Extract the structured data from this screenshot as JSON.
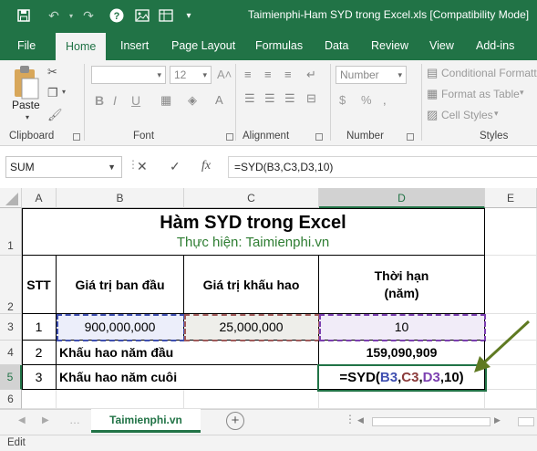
{
  "window": {
    "title": "Taimienphi-Ham SYD trong Excel.xls  [Compatibility Mode]"
  },
  "quick_access": [
    "save-icon",
    "undo-icon",
    "redo-icon",
    "help-icon",
    "image-icon",
    "format-icon",
    "customize-icon"
  ],
  "ribbon_tabs": [
    {
      "label": "File"
    },
    {
      "label": "Home"
    },
    {
      "label": "Insert"
    },
    {
      "label": "Page Layout"
    },
    {
      "label": "Formulas"
    },
    {
      "label": "Data"
    },
    {
      "label": "Review"
    },
    {
      "label": "View"
    },
    {
      "label": "Add-ins"
    }
  ],
  "active_tab": "Home",
  "ribbon": {
    "clipboard": {
      "paste_label": "Paste",
      "group_label": "Clipboard"
    },
    "font": {
      "font_size": "12",
      "group_label": "Font",
      "bold": "B",
      "italic": "I",
      "underline": "U"
    },
    "alignment": {
      "group_label": "Alignment"
    },
    "number": {
      "format": "Number",
      "group_label": "Number",
      "currency": "$",
      "percent": "%"
    },
    "styles": {
      "conditional_formatting": "Conditional Formatti",
      "format_as_table": "Format as Table",
      "cell_styles": "Cell Styles",
      "group_label": "Styles"
    }
  },
  "formula_bar": {
    "name_box": "SUM",
    "formula": "=SYD(B3,C3,D3,10)",
    "fx_label": "fx"
  },
  "columns": [
    "A",
    "B",
    "C",
    "D",
    "E"
  ],
  "rows": [
    "1",
    "2",
    "3",
    "4",
    "5",
    "6"
  ],
  "sheet": {
    "title": "Hàm SYD trong Excel",
    "subtitle": "Thực hiện: Taimienphi.vn",
    "headers": {
      "stt": "STT",
      "initial_value": "Giá trị ban đầu",
      "salvage_value": "Giá trị khấu hao",
      "life_line1": "Thời hạn",
      "life_line2": "(năm)"
    },
    "row3": {
      "stt": "1",
      "initial_value": "900,000,000",
      "salvage_value": "25,000,000",
      "life": "10"
    },
    "row4": {
      "stt": "2",
      "label": "Khấu hao năm đầu",
      "value": "159,090,909"
    },
    "row5": {
      "stt": "3",
      "label": "Khấu hao năm cuôi",
      "formula_parts": [
        {
          "text": "=SYD(",
          "color": "#000000"
        },
        {
          "text": "B3",
          "color": "#3f4fb0"
        },
        {
          "text": ",",
          "color": "#000000"
        },
        {
          "text": "C3",
          "color": "#8c3b3b"
        },
        {
          "text": ",",
          "color": "#000000"
        },
        {
          "text": "D3",
          "color": "#7b3fb0"
        },
        {
          "text": ",10)",
          "color": "#000000"
        }
      ]
    }
  },
  "sheet_tabs": [
    {
      "label": "Taimienphi.vn"
    }
  ],
  "status": {
    "text": "Edit"
  },
  "colors": {
    "accent": "#217346",
    "ref_b3": "#3f4fb0",
    "ref_c3": "#8c3b3b",
    "ref_d3": "#7b3fb0",
    "arrow": "#5f7a22"
  }
}
